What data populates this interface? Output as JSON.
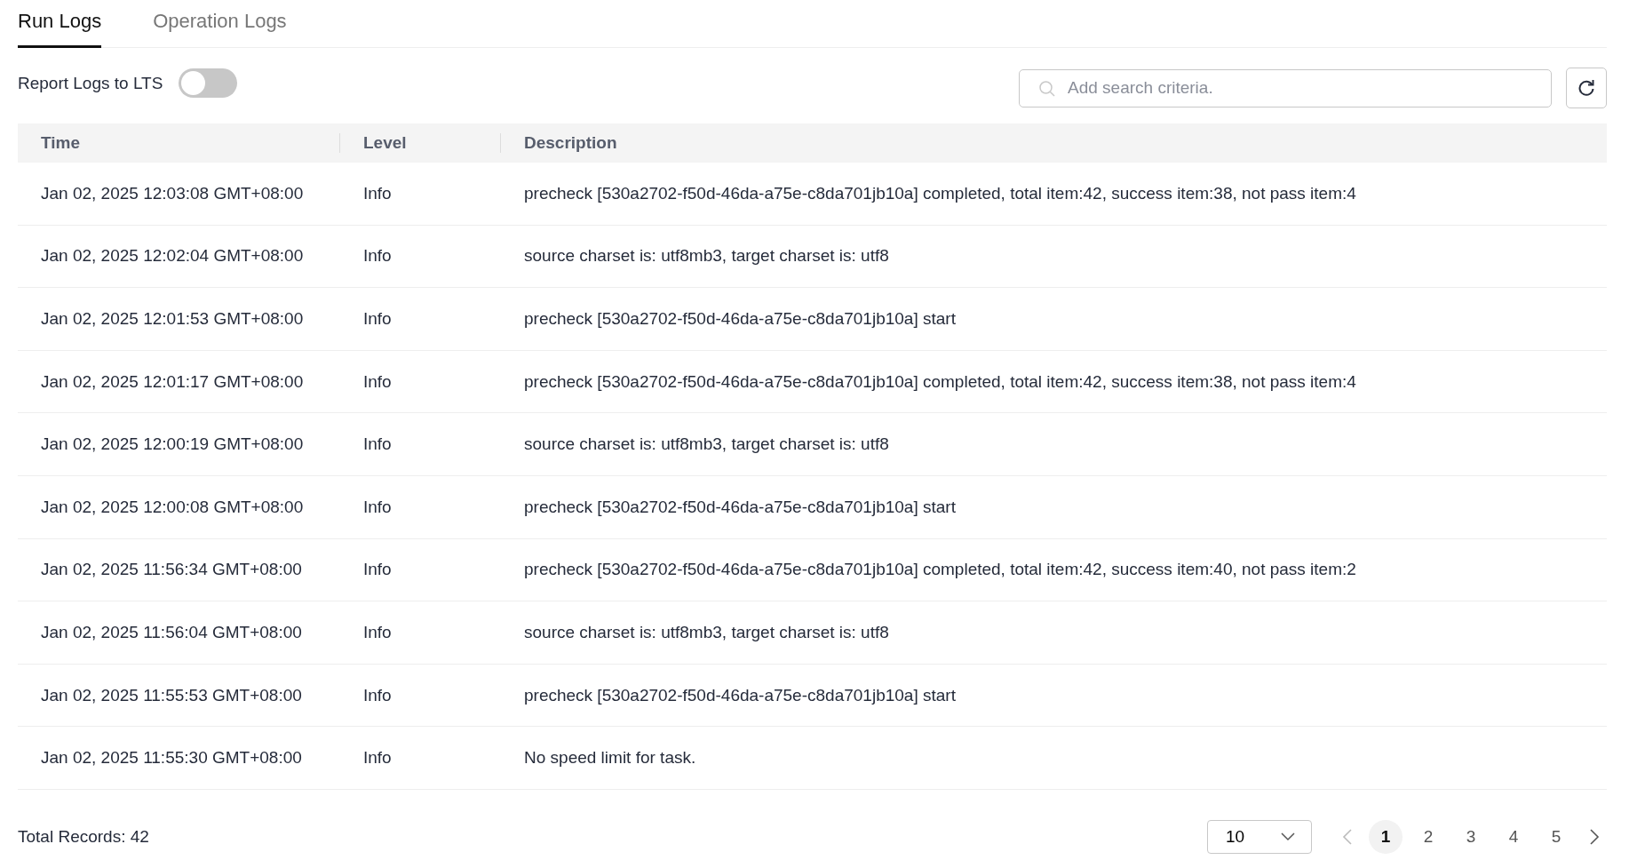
{
  "tabs": [
    {
      "label": "Run Logs",
      "selected": true
    },
    {
      "label": "Operation Logs",
      "selected": false
    }
  ],
  "report_toggle": {
    "label": "Report Logs to LTS",
    "on": false
  },
  "search": {
    "placeholder": "Add search criteria."
  },
  "table": {
    "columns": [
      "Time",
      "Level",
      "Description"
    ],
    "rows": [
      {
        "time": "Jan 02, 2025 12:03:08 GMT+08:00",
        "level": "Info",
        "description": "precheck [530a2702-f50d-46da-a75e-c8da701jb10a] completed, total item:42, success item:38, not pass item:4"
      },
      {
        "time": "Jan 02, 2025 12:02:04 GMT+08:00",
        "level": "Info",
        "description": "source charset is: utf8mb3, target charset is: utf8"
      },
      {
        "time": "Jan 02, 2025 12:01:53 GMT+08:00",
        "level": "Info",
        "description": "precheck [530a2702-f50d-46da-a75e-c8da701jb10a] start"
      },
      {
        "time": "Jan 02, 2025 12:01:17 GMT+08:00",
        "level": "Info",
        "description": "precheck [530a2702-f50d-46da-a75e-c8da701jb10a] completed, total item:42, success item:38, not pass item:4"
      },
      {
        "time": "Jan 02, 2025 12:00:19 GMT+08:00",
        "level": "Info",
        "description": "source charset is: utf8mb3, target charset is: utf8"
      },
      {
        "time": "Jan 02, 2025 12:00:08 GMT+08:00",
        "level": "Info",
        "description": "precheck [530a2702-f50d-46da-a75e-c8da701jb10a] start"
      },
      {
        "time": "Jan 02, 2025 11:56:34 GMT+08:00",
        "level": "Info",
        "description": "precheck [530a2702-f50d-46da-a75e-c8da701jb10a] completed, total item:42, success item:40, not pass item:2"
      },
      {
        "time": "Jan 02, 2025 11:56:04 GMT+08:00",
        "level": "Info",
        "description": "source charset is: utf8mb3, target charset is: utf8"
      },
      {
        "time": "Jan 02, 2025 11:55:53 GMT+08:00",
        "level": "Info",
        "description": "precheck [530a2702-f50d-46da-a75e-c8da701jb10a] start"
      },
      {
        "time": "Jan 02, 2025 11:55:30 GMT+08:00",
        "level": "Info",
        "description": "No speed limit for task."
      }
    ]
  },
  "footer": {
    "total": "Total Records: 42",
    "page_size": "10",
    "pages": [
      {
        "label": "1",
        "selected": true
      },
      {
        "label": "2",
        "selected": false
      },
      {
        "label": "3",
        "selected": false
      },
      {
        "label": "4",
        "selected": false
      },
      {
        "label": "5",
        "selected": false
      }
    ]
  }
}
